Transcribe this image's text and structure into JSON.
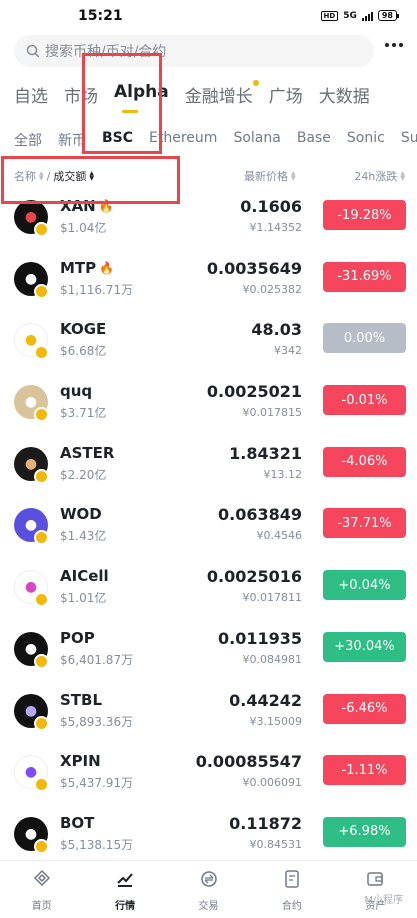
{
  "status": {
    "time": "15:21",
    "hd": "HD",
    "network": "5G",
    "battery": "98"
  },
  "search": {
    "placeholder": "搜索币种/币对/合约"
  },
  "main_tabs": [
    {
      "label": "自选",
      "active": false
    },
    {
      "label": "市场",
      "active": false
    },
    {
      "label": "Alpha",
      "active": true
    },
    {
      "label": "金融增长",
      "active": false,
      "dot": true
    },
    {
      "label": "广场",
      "active": false
    },
    {
      "label": "大数据",
      "active": false
    }
  ],
  "sub_tabs": [
    {
      "label": "全部",
      "active": false
    },
    {
      "label": "新币",
      "active": false
    },
    {
      "label": "BSC",
      "active": true
    },
    {
      "label": "Ethereum",
      "active": false
    },
    {
      "label": "Solana",
      "active": false
    },
    {
      "label": "Base",
      "active": false
    },
    {
      "label": "Sonic",
      "active": false
    },
    {
      "label": "Sui",
      "active": false
    }
  ],
  "columns": {
    "name": "名称",
    "volume": "成交额",
    "price": "最新价格",
    "change": "24h涨跌"
  },
  "colors": {
    "up": "#2ebd85",
    "down": "#f6465d",
    "flat": "#b7bdc6",
    "accent": "#f0b90b",
    "highlight": "#e8464b"
  },
  "rows": [
    {
      "symbol": "XAN",
      "hot": true,
      "volume": "$1.04亿",
      "price": "0.1606",
      "fiat": "¥1.14352",
      "change": "-19.28%",
      "dir": "down",
      "icon": "xan-logo",
      "logo_bg": "#111111",
      "logo_fg": "#e8464b"
    },
    {
      "symbol": "MTP",
      "hot": true,
      "volume": "$1,116.71万",
      "price": "0.0035649",
      "fiat": "¥0.025382",
      "change": "-31.69%",
      "dir": "down",
      "icon": "mtp-logo",
      "logo_bg": "#111111",
      "logo_fg": "#ffffff"
    },
    {
      "symbol": "KOGE",
      "hot": false,
      "volume": "$6.68亿",
      "price": "48.03",
      "fiat": "¥342",
      "change": "0.00%",
      "dir": "flat",
      "icon": "koge-logo",
      "logo_bg": "#ffffff",
      "logo_fg": "#f0b90b"
    },
    {
      "symbol": "quq",
      "hot": false,
      "volume": "$3.71亿",
      "price": "0.0025021",
      "fiat": "¥0.017815",
      "change": "-0.01%",
      "dir": "down",
      "icon": "quq-logo",
      "logo_bg": "#d9c39a",
      "logo_fg": "#ffffff"
    },
    {
      "symbol": "ASTER",
      "hot": false,
      "volume": "$2.20亿",
      "price": "1.84321",
      "fiat": "¥13.12",
      "change": "-4.06%",
      "dir": "down",
      "icon": "aster-logo",
      "logo_bg": "#1a1a1a",
      "logo_fg": "#e9b07b"
    },
    {
      "symbol": "WOD",
      "hot": false,
      "volume": "$1.43亿",
      "price": "0.063849",
      "fiat": "¥0.4546",
      "change": "-37.71%",
      "dir": "down",
      "icon": "wod-logo",
      "logo_bg": "#5b4fe0",
      "logo_fg": "#ffffff"
    },
    {
      "symbol": "AICell",
      "hot": false,
      "volume": "$1.01亿",
      "price": "0.0025016",
      "fiat": "¥0.017811",
      "change": "+0.04%",
      "dir": "up",
      "icon": "aicell-logo",
      "logo_bg": "#ffffff",
      "logo_fg": "#d946c0"
    },
    {
      "symbol": "POP",
      "hot": false,
      "volume": "$6,401.87万",
      "price": "0.011935",
      "fiat": "¥0.084981",
      "change": "+30.04%",
      "dir": "up",
      "icon": "pop-logo",
      "logo_bg": "#111111",
      "logo_fg": "#ffffff"
    },
    {
      "symbol": "STBL",
      "hot": false,
      "volume": "$5,893.36万",
      "price": "0.44242",
      "fiat": "¥3.15009",
      "change": "-6.46%",
      "dir": "down",
      "icon": "stbl-logo",
      "logo_bg": "#111111",
      "logo_fg": "#b9a8ff"
    },
    {
      "symbol": "XPIN",
      "hot": false,
      "volume": "$5,437.91万",
      "price": "0.00085547",
      "fiat": "¥0.006091",
      "change": "-1.11%",
      "dir": "down",
      "icon": "xpin-logo",
      "logo_bg": "#ffffff",
      "logo_fg": "#7b4dff"
    },
    {
      "symbol": "BOT",
      "hot": false,
      "volume": "$5,138.15万",
      "price": "0.11872",
      "fiat": "¥0.84531",
      "change": "+6.98%",
      "dir": "up",
      "icon": "bot-logo",
      "logo_bg": "#111111",
      "logo_fg": "#ffffff"
    }
  ],
  "bottom_nav": [
    {
      "label": "首页",
      "icon": "home-icon",
      "active": false
    },
    {
      "label": "行情",
      "icon": "market-icon",
      "active": true
    },
    {
      "label": "交易",
      "icon": "trade-icon",
      "active": false
    },
    {
      "label": "合约",
      "icon": "futures-icon",
      "active": false
    },
    {
      "label": "资产",
      "icon": "wallet-icon",
      "active": false
    }
  ],
  "watermark": "M小程序"
}
